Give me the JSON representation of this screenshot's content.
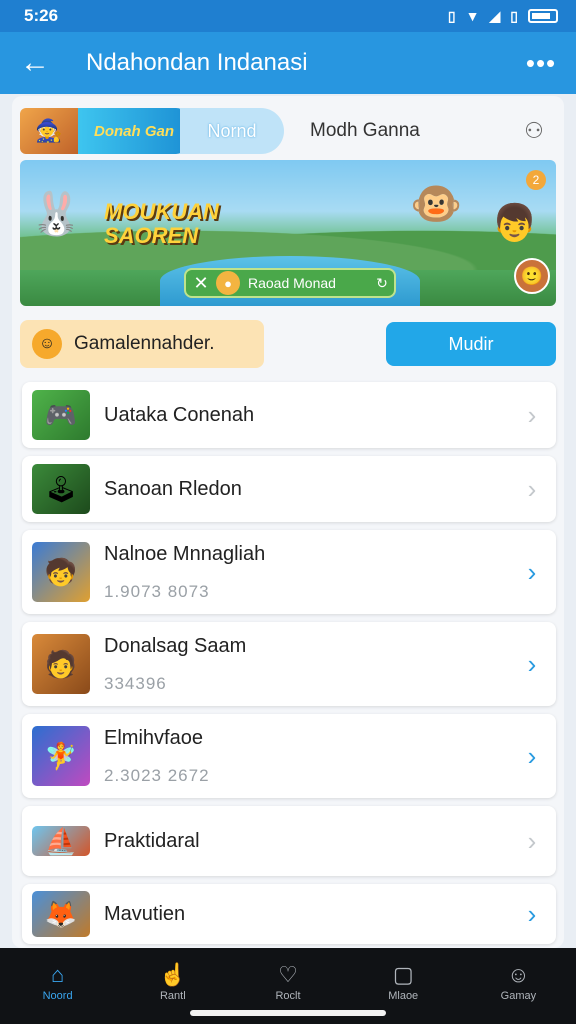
{
  "status": {
    "time": "5:26",
    "extra_icon": "settings-icon"
  },
  "appbar": {
    "title": "Ndahondan Indanasi",
    "back_icon": "back-arrow-icon",
    "more_icon": "more-dots-icon"
  },
  "tabs": {
    "logo_text": "Donah Gan",
    "active": "Nornd",
    "other": "Modh Ganna"
  },
  "banner": {
    "title_line1": "MOUKUAN",
    "title_line2": "SAOREN",
    "bar_label": "Raoad Monad",
    "badge": "2"
  },
  "info": {
    "text": "Gamalennahder.",
    "button": "Mudir"
  },
  "games": [
    {
      "title": "Uataka Conenah",
      "sub": ""
    },
    {
      "title": "Sanoan Rledon",
      "sub": ""
    },
    {
      "title": "Nalnoe Mnnagliah",
      "sub": "1.9073 8073"
    },
    {
      "title": "Donalsag Saam",
      "sub": "334396"
    },
    {
      "title": "Elmihvfaoe",
      "sub": "2.3023 2672"
    },
    {
      "title": "Praktidaral",
      "sub": ""
    },
    {
      "title": "Mavutien",
      "sub": ""
    }
  ],
  "bottomnav": [
    {
      "label": "Noord",
      "icon": "home-icon"
    },
    {
      "label": "Rantl",
      "icon": "hand-icon"
    },
    {
      "label": "Roclt",
      "icon": "heart-icon"
    },
    {
      "label": "Mlaoe",
      "icon": "book-icon"
    },
    {
      "label": "Gamay",
      "icon": "person-icon"
    }
  ]
}
